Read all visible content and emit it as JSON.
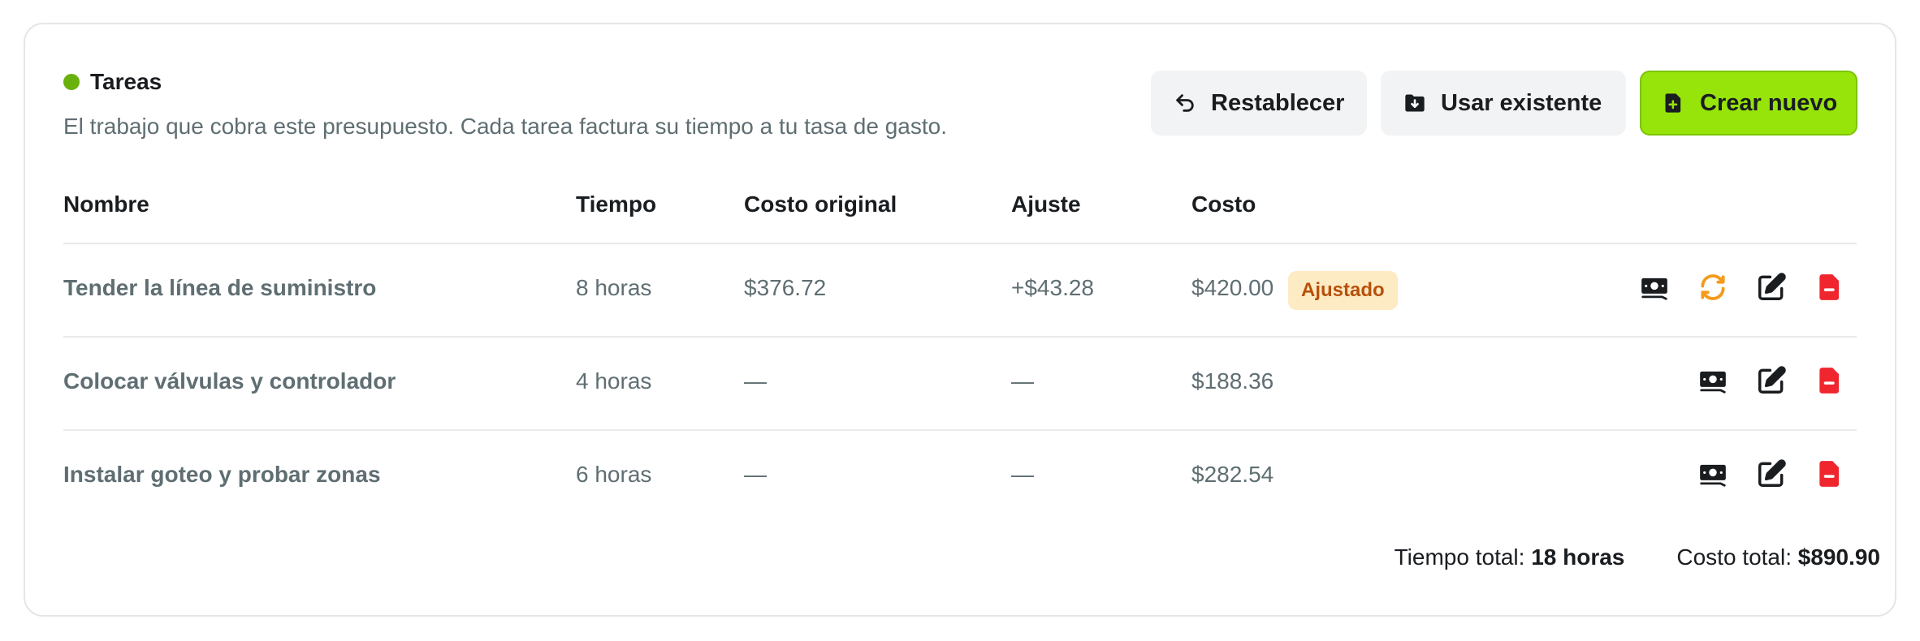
{
  "section": {
    "title": "Tareas",
    "subtitle": "El trabajo que cobra este presupuesto. Cada tarea factura su tiempo a tu tasa de gasto.",
    "status_color": "#6bb10d"
  },
  "actions": {
    "reset_label": "Restablecer",
    "existing_label": "Usar existente",
    "new_label": "Crear nuevo"
  },
  "columns": [
    "Nombre",
    "Tiempo",
    "Costo original",
    "Ajuste",
    "Costo"
  ],
  "rows": [
    {
      "name": "Tender la línea de suministro",
      "time": "8 horas",
      "original": "$376.72",
      "adjust": "+$43.28",
      "cost": "$420.00",
      "badge": "Ajustado"
    },
    {
      "name": "Colocar válvulas y controlador",
      "time": "4 horas",
      "original": "—",
      "adjust": "—",
      "cost": "$188.36"
    },
    {
      "name": "Instalar goteo y probar zonas",
      "time": "6 horas",
      "original": "—",
      "adjust": "—",
      "cost": "$282.54"
    }
  ],
  "totals": {
    "time_label": "Tiempo total:",
    "time_value": "18 horas",
    "cost_label": "Costo total:",
    "cost_value": "$890.90"
  },
  "colors": {
    "accent": "#97e40b",
    "badge_bg": "#fdebc4",
    "badge_text": "#b8500b",
    "delete": "#f0262f",
    "refresh": "#f59a1b"
  }
}
